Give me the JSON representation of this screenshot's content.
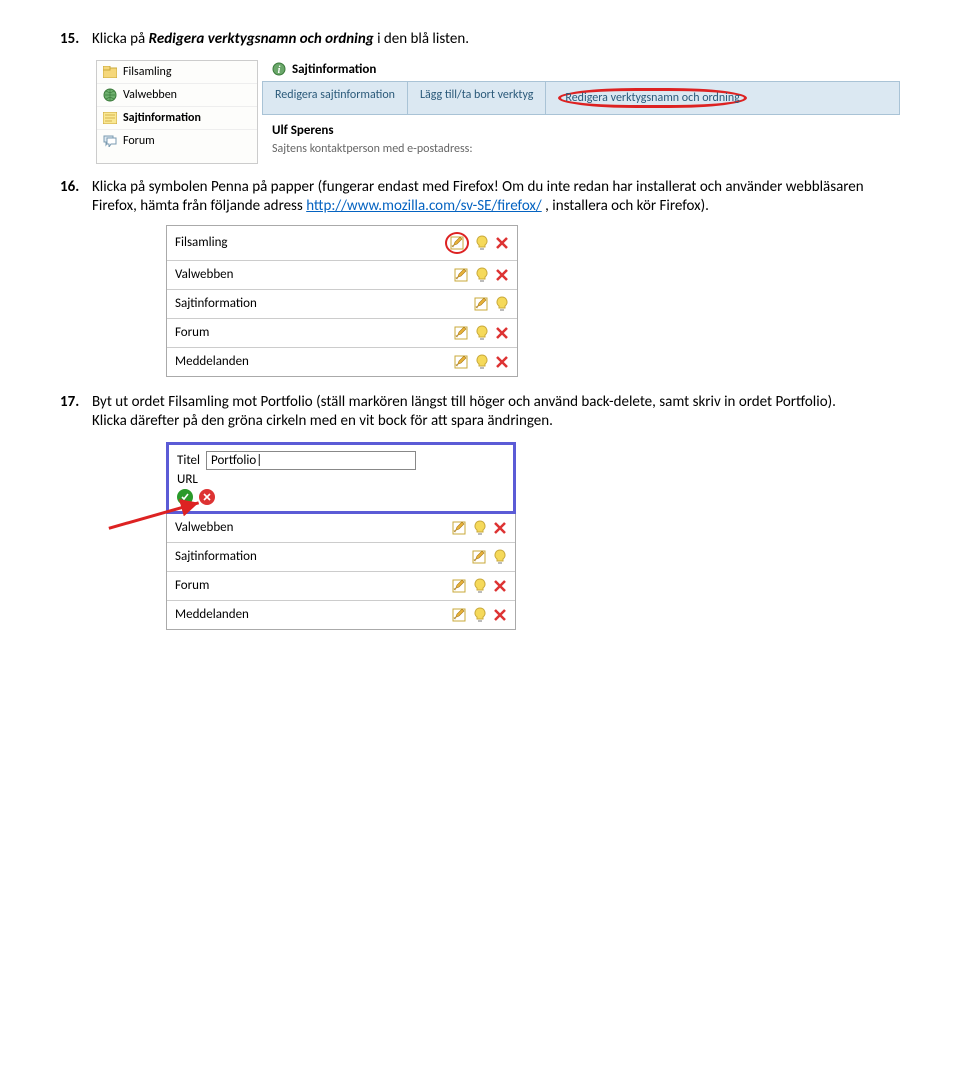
{
  "step15": {
    "num": "15.",
    "text_pre": "Klicka på ",
    "bold_italic": "Redigera verktygsnamn och ordning",
    "text_post": " i den blå listen."
  },
  "shot1": {
    "sidebar": [
      "Filsamling",
      "Valwebben",
      "Sajtinformation",
      "Forum"
    ],
    "sidebar_active_index": 2,
    "title": "Sajtinformation",
    "tabs": [
      "Redigera sajtinformation",
      "Lägg till/ta bort verktyg",
      "Redigera verktygsnamn och ordning"
    ],
    "circled_tab_index": 2,
    "user_name": "Ulf Sperens",
    "contact_label": "Sajtens kontaktperson med e-postadress:"
  },
  "step16": {
    "num": "16.",
    "line1": "Klicka på symbolen Penna på papper (fungerar endast med Firefox! Om du inte redan har installerat och använder webbläsaren Firefox, hämta från följande adress ",
    "link_text": "http://www.mozilla.com/sv-SE/firefox/",
    "line2": "  , installera och kör Firefox)."
  },
  "shot2": {
    "rows": [
      {
        "label": "Filsamling",
        "icons": [
          "pen",
          "bulb",
          "x"
        ],
        "circle_pen": true
      },
      {
        "label": "Valwebben",
        "icons": [
          "pen",
          "bulb",
          "x"
        ]
      },
      {
        "label": "Sajtinformation",
        "icons": [
          "pen",
          "bulb"
        ]
      },
      {
        "label": "Forum",
        "icons": [
          "pen",
          "bulb",
          "x"
        ]
      },
      {
        "label": "Meddelanden",
        "icons": [
          "pen",
          "bulb",
          "x"
        ]
      }
    ]
  },
  "step17": {
    "num": "17.",
    "text": "Byt ut ordet Filsamling mot Portfolio (ställ markören längst till höger och använd back-delete, samt skriv in ordet Portfolio).",
    "line2": "Klicka därefter på den gröna cirkeln med en vit bock för att spara ändringen."
  },
  "shot3": {
    "field_title_label": "Titel",
    "field_title_value": "Portfolio|",
    "field_url_label": "URL",
    "rows": [
      {
        "label": "Valwebben",
        "icons": [
          "pen",
          "bulb",
          "x"
        ]
      },
      {
        "label": "Sajtinformation",
        "icons": [
          "pen",
          "bulb"
        ]
      },
      {
        "label": "Forum",
        "icons": [
          "pen",
          "bulb",
          "x"
        ]
      },
      {
        "label": "Meddelanden",
        "icons": [
          "pen",
          "bulb",
          "x"
        ]
      }
    ]
  }
}
